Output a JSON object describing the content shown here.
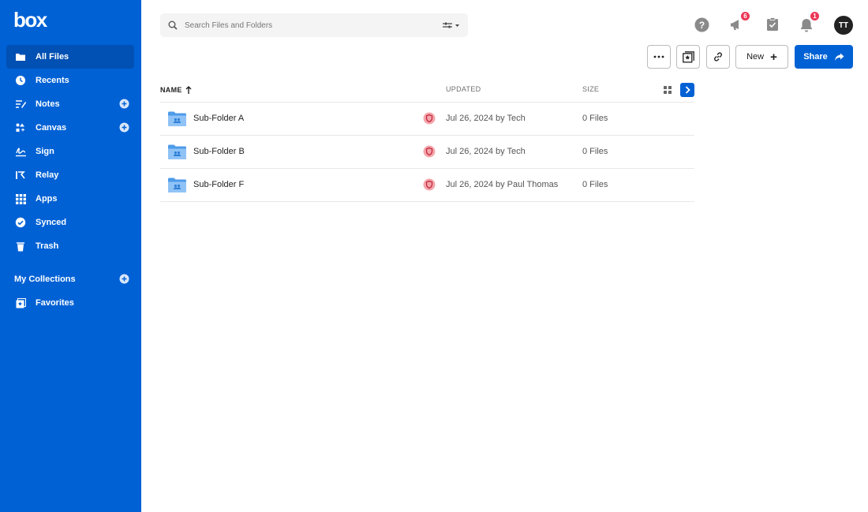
{
  "brand": {
    "logo_text": "box",
    "accent": "#0061d5"
  },
  "sidebar": {
    "items": [
      {
        "label": "All Files",
        "icon": "folder-icon",
        "active": true
      },
      {
        "label": "Recents",
        "icon": "clock-icon"
      },
      {
        "label": "Notes",
        "icon": "notes-icon",
        "add": true
      },
      {
        "label": "Canvas",
        "icon": "canvas-icon",
        "add": true
      },
      {
        "label": "Sign",
        "icon": "sign-icon"
      },
      {
        "label": "Relay",
        "icon": "relay-icon"
      },
      {
        "label": "Apps",
        "icon": "apps-grid-icon"
      },
      {
        "label": "Synced",
        "icon": "check-circle-icon"
      },
      {
        "label": "Trash",
        "icon": "trash-icon"
      }
    ],
    "collections": {
      "label": "My Collections",
      "items": [
        {
          "label": "Favorites",
          "icon": "star-icon"
        }
      ]
    }
  },
  "search": {
    "placeholder": "Search Files and Folders",
    "value": ""
  },
  "header": {
    "icons": [
      {
        "name": "help-icon"
      },
      {
        "name": "announcement-icon",
        "badge": "6"
      },
      {
        "name": "tasks-icon"
      },
      {
        "name": "bell-icon",
        "badge": "1"
      }
    ],
    "avatar_initials": "TT"
  },
  "toolbar": {
    "new_label": "New",
    "share_label": "Share"
  },
  "table": {
    "headers": {
      "name": "NAME",
      "updated": "UPDATED",
      "size": "SIZE"
    },
    "rows": [
      {
        "name": "Sub-Folder A",
        "updated": "Jul 26, 2024 by Tech",
        "size": "0 Files"
      },
      {
        "name": "Sub-Folder B",
        "updated": "Jul 26, 2024 by Tech",
        "size": "0 Files"
      },
      {
        "name": "Sub-Folder F",
        "updated": "Jul 26, 2024 by Paul Thomas",
        "size": "0 Files"
      }
    ]
  }
}
